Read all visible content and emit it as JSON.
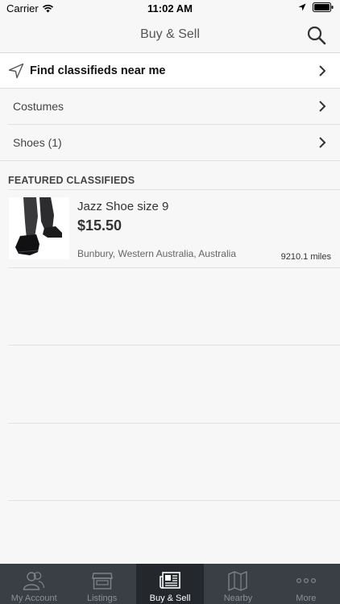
{
  "status_bar": {
    "carrier": "Carrier",
    "time": "11:02 AM"
  },
  "nav": {
    "title": "Buy & Sell",
    "search_icon": "search-icon"
  },
  "find_nearby": {
    "label": "Find classifieds near me",
    "icon": "location-arrow-icon"
  },
  "categories": [
    {
      "label": "Costumes"
    },
    {
      "label": "Shoes (1)"
    }
  ],
  "featured": {
    "header": "FEATURED CLASSIFIEDS",
    "items": [
      {
        "title": "Jazz Shoe size 9",
        "price": "$15.50",
        "location": "Bunbury, Western Australia, Australia",
        "distance": "9210.1 miles"
      }
    ]
  },
  "tabs": [
    {
      "label": "My Account",
      "icon": "users-icon",
      "active": false
    },
    {
      "label": "Listings",
      "icon": "storefront-icon",
      "active": false
    },
    {
      "label": "Buy & Sell",
      "icon": "newspaper-icon",
      "active": true
    },
    {
      "label": "Nearby",
      "icon": "map-icon",
      "active": false
    },
    {
      "label": "More",
      "icon": "more-dots-icon",
      "active": false
    }
  ],
  "colors": {
    "tab_bar": "#3a3f45",
    "tab_active": "#24282d",
    "background": "#f7f7f7"
  }
}
